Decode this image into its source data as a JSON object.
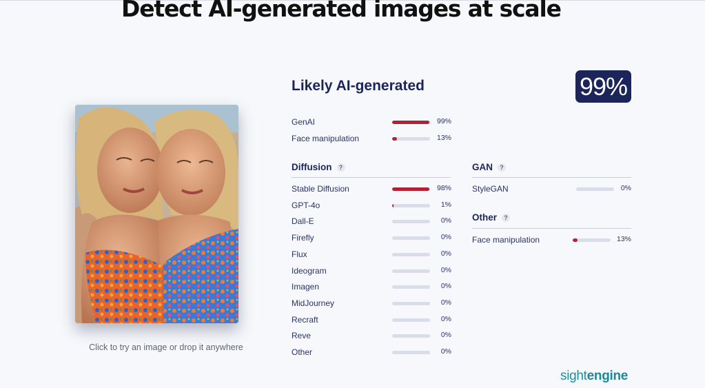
{
  "headline": "Detect AI-generated images at scale",
  "upload_hint": "Click to try an image or drop it anywhere",
  "verdict": "Likely AI-generated",
  "overall_score": "99%",
  "summary": [
    {
      "label": "GenAI",
      "value": 99,
      "pct": "99%"
    },
    {
      "label": "Face manipulation",
      "value": 13,
      "pct": "13%"
    }
  ],
  "diffusion": {
    "title": "Diffusion",
    "help": "?",
    "items": [
      {
        "label": "Stable Diffusion",
        "value": 98,
        "pct": "98%"
      },
      {
        "label": "GPT-4o",
        "value": 1,
        "pct": "1%"
      },
      {
        "label": "Dall-E",
        "value": 0,
        "pct": "0%"
      },
      {
        "label": "Firefly",
        "value": 0,
        "pct": "0%"
      },
      {
        "label": "Flux",
        "value": 0,
        "pct": "0%"
      },
      {
        "label": "Ideogram",
        "value": 0,
        "pct": "0%"
      },
      {
        "label": "Imagen",
        "value": 0,
        "pct": "0%"
      },
      {
        "label": "MidJourney",
        "value": 0,
        "pct": "0%"
      },
      {
        "label": "Recraft",
        "value": 0,
        "pct": "0%"
      },
      {
        "label": "Reve",
        "value": 0,
        "pct": "0%"
      },
      {
        "label": "Other",
        "value": 0,
        "pct": "0%"
      }
    ]
  },
  "gan": {
    "title": "GAN",
    "help": "?",
    "items": [
      {
        "label": "StyleGAN",
        "value": 0,
        "pct": "0%"
      }
    ]
  },
  "other": {
    "title": "Other",
    "help": "?",
    "items": [
      {
        "label": "Face manipulation",
        "value": 13,
        "pct": "13%"
      }
    ]
  },
  "brand": {
    "part1": "sight",
    "part2": "engine"
  },
  "colors": {
    "accent": "#1b2559",
    "bar_fill": "#b22234",
    "bar_track": "#d9dde7",
    "brand": "#1f8fa0"
  }
}
